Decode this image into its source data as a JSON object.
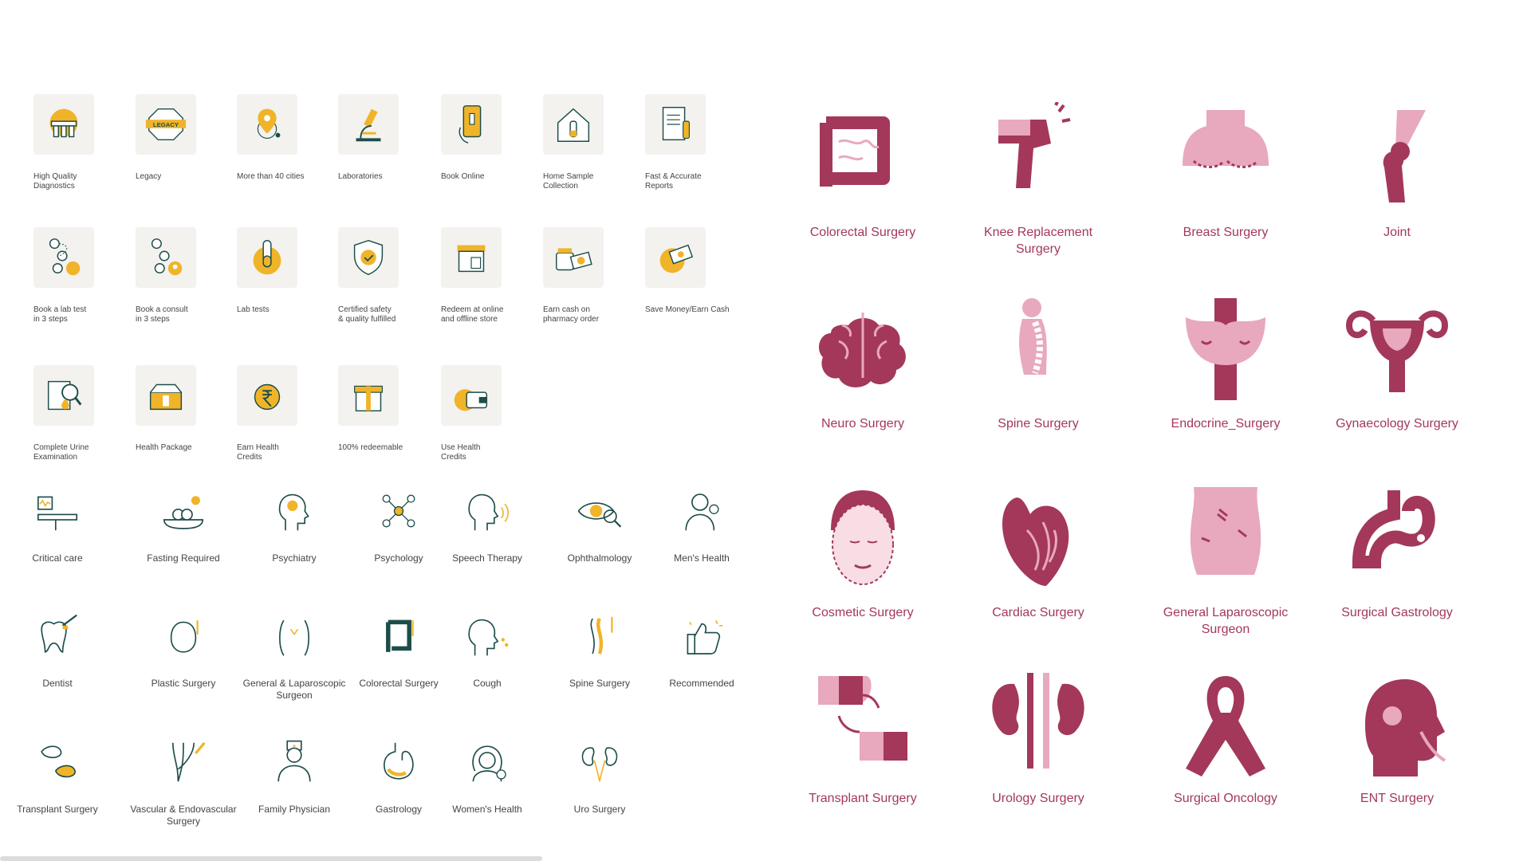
{
  "colors": {
    "accent_yellow": "#f0b429",
    "dark_teal": "#1d4d4a",
    "maroon": "#a3385a",
    "maroon_light": "#e8a8bd"
  },
  "tile_icons": [
    {
      "label": "High Quality\nDiagnostics",
      "icon": "test-tubes-icon"
    },
    {
      "label": "Legacy",
      "icon": "legacy-badge-icon",
      "badge_text": "LEGACY"
    },
    {
      "label": "More than 40 cities",
      "icon": "location-pin-icon"
    },
    {
      "label": "Laboratories",
      "icon": "microscope-icon"
    },
    {
      "label": "Book Online",
      "icon": "phone-booking-icon"
    },
    {
      "label": "Home Sample\nCollection",
      "icon": "home-sample-icon"
    },
    {
      "label": "Fast & Accurate\nReports",
      "icon": "report-icon"
    },
    {
      "label": "Book a lab test\nin 3 steps",
      "icon": "three-steps-icon"
    },
    {
      "label": "Book a consult\nin 3 steps",
      "icon": "three-steps-consult-icon"
    },
    {
      "label": "Lab tests",
      "icon": "lab-test-icon"
    },
    {
      "label": "Certified safety\n& quality fulfilled",
      "icon": "shield-check-icon"
    },
    {
      "label": "Redeem at online\nand offline store",
      "icon": "store-icon"
    },
    {
      "label": "Earn cash on\npharmacy order",
      "icon": "pharmacy-cash-icon"
    },
    {
      "label": "Save Money/Earn Cash",
      "icon": "save-money-icon"
    },
    {
      "label": "Complete Urine\nExamination",
      "icon": "urine-exam-icon"
    },
    {
      "label": "Health Package",
      "icon": "health-package-icon"
    },
    {
      "label": "Earn Health\nCredits",
      "icon": "rupee-coin-icon"
    },
    {
      "label": "100% redeemable",
      "icon": "gift-icon"
    },
    {
      "label": "Use Health\nCredits",
      "icon": "wallet-icon"
    }
  ],
  "line_icons": [
    {
      "label": "Critical care",
      "icon": "critical-care-icon"
    },
    {
      "label": "Fasting Required",
      "icon": "fasting-icon"
    },
    {
      "label": "Psychiatry",
      "icon": "psychiatry-icon"
    },
    {
      "label": "Psychology",
      "icon": "psychology-icon"
    },
    {
      "label": "Speech Therapy",
      "icon": "speech-therapy-icon"
    },
    {
      "label": "Ophthalmology",
      "icon": "eye-icon"
    },
    {
      "label": "Men's Health",
      "icon": "mens-health-icon"
    },
    {
      "label": "Dentist",
      "icon": "tooth-icon"
    },
    {
      "label": "Plastic Surgery",
      "icon": "plastic-surgery-icon"
    },
    {
      "label": "General & Laparoscopic\nSurgeon",
      "icon": "laparoscopic-icon"
    },
    {
      "label": "Colorectal Surgery",
      "icon": "colon-icon"
    },
    {
      "label": "Cough",
      "icon": "cough-icon"
    },
    {
      "label": "Spine Surgery",
      "icon": "spine-icon"
    },
    {
      "label": "Recommended",
      "icon": "thumbs-up-icon"
    },
    {
      "label": "Transplant Surgery",
      "icon": "transplant-icon"
    },
    {
      "label": "Vascular & Endovascular\nSurgery",
      "icon": "vascular-icon"
    },
    {
      "label": "Family Physician",
      "icon": "physician-icon"
    },
    {
      "label": "Gastrology",
      "icon": "stomach-icon"
    },
    {
      "label": "Women's Health",
      "icon": "womens-health-icon"
    },
    {
      "label": "Uro Surgery",
      "icon": "kidney-icon"
    }
  ],
  "maroon_icons": [
    {
      "label": "Colorectal Surgery",
      "icon": "colon-icon"
    },
    {
      "label": "Knee Replacement\nSurgery",
      "icon": "knee-icon"
    },
    {
      "label": "Breast Surgery",
      "icon": "breast-icon"
    },
    {
      "label": "Joint",
      "icon": "joint-icon"
    },
    {
      "label": "Neuro Surgery",
      "icon": "brain-icon"
    },
    {
      "label": "Spine Surgery",
      "icon": "spine-icon"
    },
    {
      "label": "Endocrine_Surgery",
      "icon": "thyroid-icon"
    },
    {
      "label": "Gynaecology Surgery",
      "icon": "uterus-icon"
    },
    {
      "label": "Cosmetic Surgery",
      "icon": "face-icon"
    },
    {
      "label": "Cardiac Surgery",
      "icon": "heart-icon"
    },
    {
      "label": "General Laparoscopic\nSurgeon",
      "icon": "abdomen-icon"
    },
    {
      "label": "Surgical Gastrology",
      "icon": "stomach-icon"
    },
    {
      "label": "Transplant Surgery",
      "icon": "liver-transplant-icon"
    },
    {
      "label": "Urology Surgery",
      "icon": "kidney-icon"
    },
    {
      "label": "Surgical Oncology",
      "icon": "ribbon-icon"
    },
    {
      "label": "ENT Surgery",
      "icon": "ent-head-icon"
    }
  ]
}
